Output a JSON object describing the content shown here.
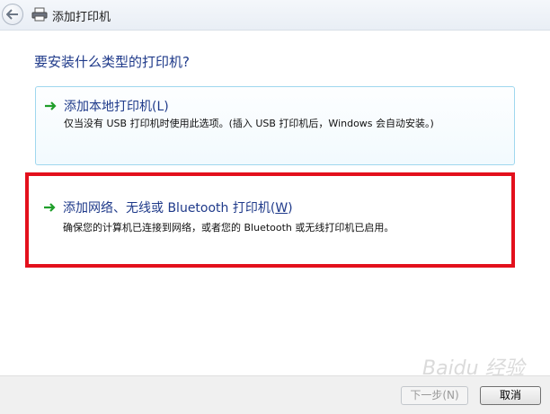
{
  "window": {
    "title": "添加打印机",
    "back_icon": "back-arrow-icon",
    "title_icon": "printer-icon"
  },
  "main": {
    "question": "要安装什么类型的打印机?",
    "options": [
      {
        "title": "添加本地打印机(L)",
        "description": "仅当没有 USB 打印机时使用此选项。(插入 USB 打印机后，Windows 会自动安装。)",
        "icon": "green-arrow-icon"
      },
      {
        "title_prefix": "添加网络、无线或 Bluetooth 打印机(",
        "title_accel": "W",
        "title_suffix": ")",
        "description": "确保您的计算机已连接到网络，或者您的 Bluetooth 或无线打印机已启用。",
        "icon": "green-arrow-icon"
      }
    ]
  },
  "footer": {
    "next_label": "下一步(N)",
    "cancel_label": "取消"
  },
  "colors": {
    "highlight_border": "#e3101c",
    "heading_text": "#1f3a8a",
    "option_border": "#9fd7ee"
  }
}
